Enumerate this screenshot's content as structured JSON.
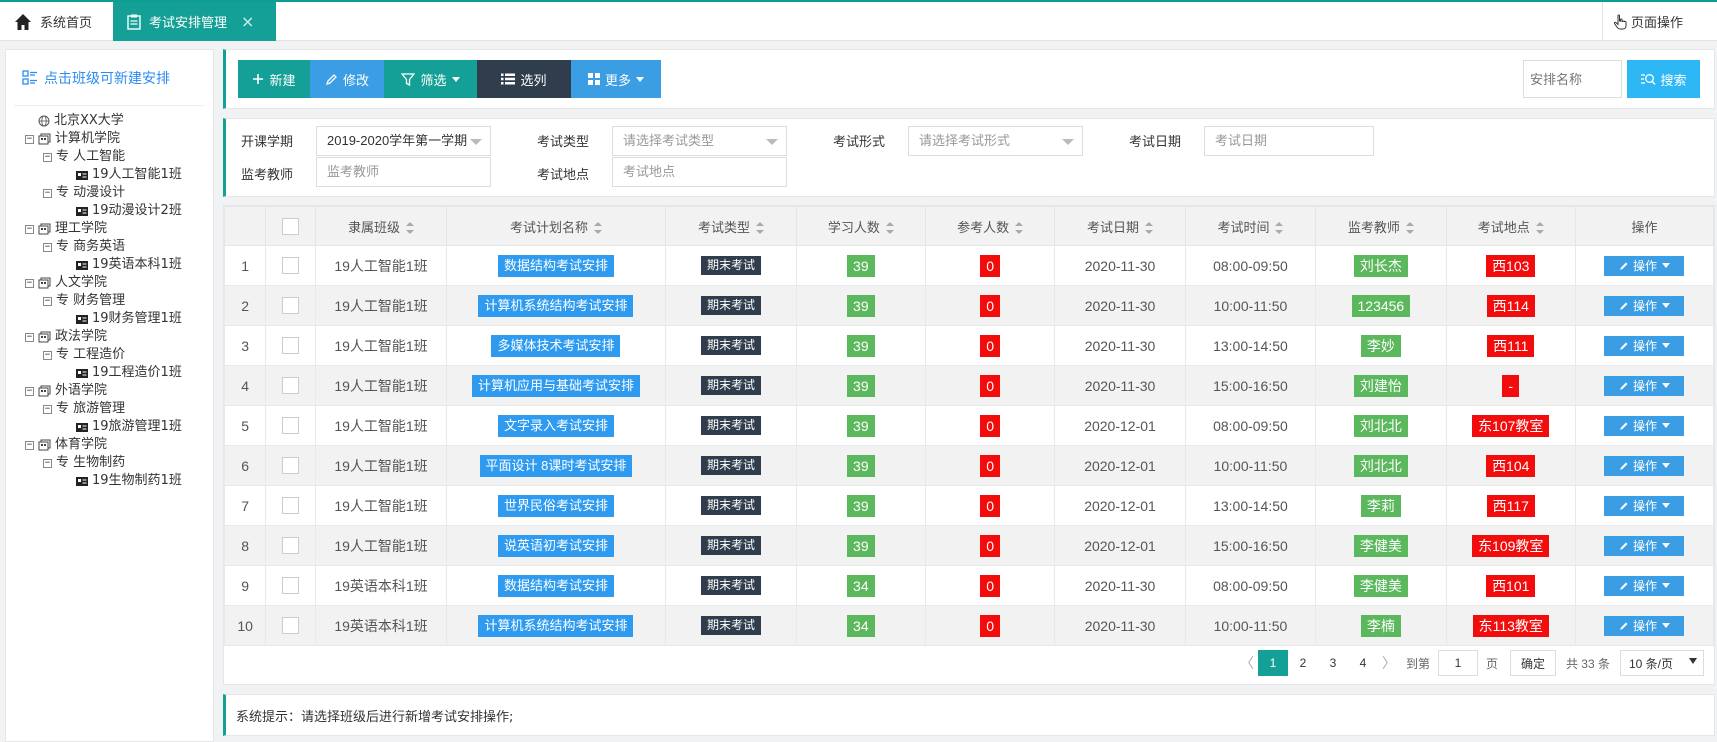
{
  "topbar": {
    "home_label": "系统首页",
    "active_tab_label": "考试安排管理",
    "close_glyph": "×",
    "page_op_label": "页面操作"
  },
  "sidebar": {
    "header": "点击班级可新建安排",
    "tree": [
      {
        "level": 0,
        "toggle": "",
        "type": "root",
        "label": "北京XX大学"
      },
      {
        "level": 1,
        "toggle": "⊟",
        "type": "college",
        "label": "计算机学院"
      },
      {
        "level": 2,
        "toggle": "⊟",
        "type": "major",
        "label": "专 人工智能"
      },
      {
        "level": 3,
        "toggle": "",
        "type": "class",
        "label": "19人工智能1班"
      },
      {
        "level": 2,
        "toggle": "⊟",
        "type": "major",
        "label": "专 动漫设计"
      },
      {
        "level": 3,
        "toggle": "",
        "type": "class",
        "label": "19动漫设计2班"
      },
      {
        "level": 1,
        "toggle": "⊟",
        "type": "college",
        "label": "理工学院"
      },
      {
        "level": 2,
        "toggle": "⊟",
        "type": "major",
        "label": "专 商务英语"
      },
      {
        "level": 3,
        "toggle": "",
        "type": "class",
        "label": "19英语本科1班"
      },
      {
        "level": 1,
        "toggle": "⊟",
        "type": "college",
        "label": "人文学院"
      },
      {
        "level": 2,
        "toggle": "⊟",
        "type": "major",
        "label": "专 财务管理"
      },
      {
        "level": 3,
        "toggle": "",
        "type": "class",
        "label": "19财务管理1班"
      },
      {
        "level": 1,
        "toggle": "⊟",
        "type": "college",
        "label": "政法学院"
      },
      {
        "level": 2,
        "toggle": "⊟",
        "type": "major",
        "label": "专 工程造价"
      },
      {
        "level": 3,
        "toggle": "",
        "type": "class",
        "label": "19工程造价1班"
      },
      {
        "level": 1,
        "toggle": "⊟",
        "type": "college",
        "label": "外语学院"
      },
      {
        "level": 2,
        "toggle": "⊟",
        "type": "major",
        "label": "专 旅游管理"
      },
      {
        "level": 3,
        "toggle": "",
        "type": "class",
        "label": "19旅游管理1班"
      },
      {
        "level": 1,
        "toggle": "⊟",
        "type": "college",
        "label": "体育学院"
      },
      {
        "level": 2,
        "toggle": "⊟",
        "type": "major",
        "label": "专 生物制药"
      },
      {
        "level": 3,
        "toggle": "",
        "type": "class",
        "label": "19生物制药1班"
      }
    ]
  },
  "toolbar": {
    "new_label": "新建",
    "edit_label": "修改",
    "filter_label": "筛选",
    "columns_label": "选列",
    "more_label": "更多",
    "search_placeholder": "安排名称",
    "search_label": "搜索"
  },
  "filters": {
    "term_label": "开课学期",
    "term_value": "2019-2020学年第一学期",
    "type_label": "考试类型",
    "type_placeholder": "请选择考试类型",
    "form_label": "考试形式",
    "form_placeholder": "请选择考试形式",
    "date_label": "考试日期",
    "date_placeholder": "考试日期",
    "teacher_label": "监考教师",
    "teacher_placeholder": "监考教师",
    "place_label": "考试地点",
    "place_placeholder": "考试地点"
  },
  "table": {
    "headers": [
      "隶属班级",
      "考试计划名称",
      "考试类型",
      "学习人数",
      "参考人数",
      "考试日期",
      "考试时间",
      "监考教师",
      "考试地点",
      "操作"
    ],
    "op_label": "操作",
    "rows": [
      {
        "no": "1",
        "cls": "19人工智能1班",
        "plan": "数据结构考试安排",
        "type": "期末考试",
        "learn": "39",
        "attend": "0",
        "date": "2020-11-30",
        "time": "08:00-09:50",
        "teacher": "刘长杰",
        "place": "西103"
      },
      {
        "no": "2",
        "cls": "19人工智能1班",
        "plan": "计算机系统结构考试安排",
        "type": "期末考试",
        "learn": "39",
        "attend": "0",
        "date": "2020-11-30",
        "time": "10:00-11:50",
        "teacher": "123456",
        "place": "西114"
      },
      {
        "no": "3",
        "cls": "19人工智能1班",
        "plan": "多媒体技术考试安排",
        "type": "期末考试",
        "learn": "39",
        "attend": "0",
        "date": "2020-11-30",
        "time": "13:00-14:50",
        "teacher": "李妙",
        "place": "西111"
      },
      {
        "no": "4",
        "cls": "19人工智能1班",
        "plan": "计算机应用与基础考试安排",
        "type": "期末考试",
        "learn": "39",
        "attend": "0",
        "date": "2020-11-30",
        "time": "15:00-16:50",
        "teacher": "刘建怡",
        "place": "-"
      },
      {
        "no": "5",
        "cls": "19人工智能1班",
        "plan": "文字录入考试安排",
        "type": "期末考试",
        "learn": "39",
        "attend": "0",
        "date": "2020-12-01",
        "time": "08:00-09:50",
        "teacher": "刘北北",
        "place": "东107教室"
      },
      {
        "no": "6",
        "cls": "19人工智能1班",
        "plan": "平面设计 8课时考试安排",
        "type": "期末考试",
        "learn": "39",
        "attend": "0",
        "date": "2020-12-01",
        "time": "10:00-11:50",
        "teacher": "刘北北",
        "place": "西104"
      },
      {
        "no": "7",
        "cls": "19人工智能1班",
        "plan": "世界民俗考试安排",
        "type": "期末考试",
        "learn": "39",
        "attend": "0",
        "date": "2020-12-01",
        "time": "13:00-14:50",
        "teacher": "李莉",
        "place": "西117"
      },
      {
        "no": "8",
        "cls": "19人工智能1班",
        "plan": "说英语初考试安排",
        "type": "期末考试",
        "learn": "39",
        "attend": "0",
        "date": "2020-12-01",
        "time": "15:00-16:50",
        "teacher": "李健美",
        "place": "东109教室"
      },
      {
        "no": "9",
        "cls": "19英语本科1班",
        "plan": "数据结构考试安排",
        "type": "期末考试",
        "learn": "34",
        "attend": "0",
        "date": "2020-11-30",
        "time": "08:00-09:50",
        "teacher": "李健美",
        "place": "西101"
      },
      {
        "no": "10",
        "cls": "19英语本科1班",
        "plan": "计算机系统结构考试安排",
        "type": "期末考试",
        "learn": "34",
        "attend": "0",
        "date": "2020-11-30",
        "time": "10:00-11:50",
        "teacher": "李楠",
        "place": "东113教室"
      }
    ]
  },
  "pager": {
    "prev": "〈",
    "next": "〉",
    "pages": [
      "1",
      "2",
      "3",
      "4"
    ],
    "current": "1",
    "goto_label": "到第",
    "goto_value": "1",
    "page_unit": "页",
    "ok_label": "确定",
    "total_label": "共 33 条",
    "size_label": "10 条/页"
  },
  "notice": {
    "text": "系统提示：请选择班级后进行新增考试安排操作;"
  },
  "colors": {
    "teal": "#14a096",
    "blue": "#2e9bf0",
    "dark": "#2f3d4c",
    "green": "#5cb85c",
    "red": "#f20c0c",
    "search": "#2db7f5"
  }
}
